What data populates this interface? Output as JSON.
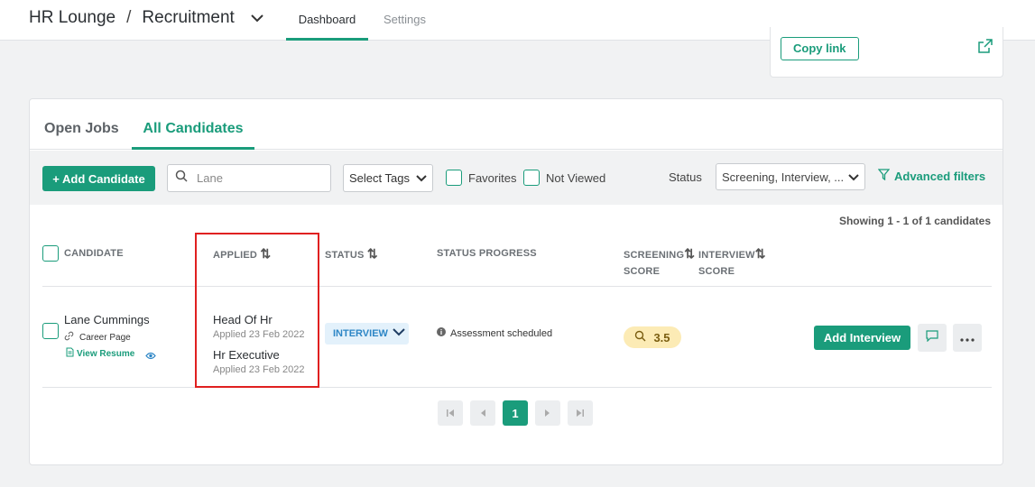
{
  "header": {
    "org": "HR Lounge",
    "separator": "/",
    "module": "Recruitment",
    "nav": [
      {
        "label": "Dashboard",
        "active": true
      },
      {
        "label": "Settings",
        "active": false
      }
    ]
  },
  "share": {
    "copy_link_label": "Copy link",
    "external_icon": "external-link-icon"
  },
  "tabs": [
    {
      "label": "Open Jobs",
      "active": false
    },
    {
      "label": "All Candidates",
      "active": true
    }
  ],
  "filters": {
    "add_candidate_label": "+ Add Candidate",
    "search_value": "Lane",
    "tags_label": "Select Tags",
    "favorites_label": "Favorites",
    "favorites_checked": false,
    "not_viewed_label": "Not Viewed",
    "not_viewed_checked": false,
    "status_label": "Status",
    "status_value": "Screening, Interview, ...",
    "advanced_label": "Advanced filters"
  },
  "showing_text": "Showing 1 - 1 of 1 candidates",
  "columns": {
    "candidate": "CANDIDATE",
    "applied": "APPLIED",
    "status": "STATUS",
    "status_progress": "STATUS PROGRESS",
    "screening_line1": "SCREENING",
    "screening_line2": "SCORE",
    "interview_line1": "INTERVIEW",
    "interview_line2": "SCORE"
  },
  "candidates": [
    {
      "name": "Lane Cummings",
      "source": "Career Page",
      "resume_label": "View Resume",
      "jobs": [
        {
          "title": "Head Of Hr",
          "applied": "Applied 23 Feb 2022"
        },
        {
          "title": "Hr Executive",
          "applied": "Applied 23 Feb 2022"
        }
      ],
      "status": "INTERVIEW",
      "progress": "Assessment scheduled",
      "screening_score": "3.5",
      "action_label": "Add Interview"
    }
  ],
  "pagination": {
    "current_page": "1"
  },
  "colors": {
    "accent": "#1a9c7b",
    "highlight": "#e02020",
    "status_pill_bg": "#e3f1fb",
    "score_bg": "#fcebb5"
  }
}
